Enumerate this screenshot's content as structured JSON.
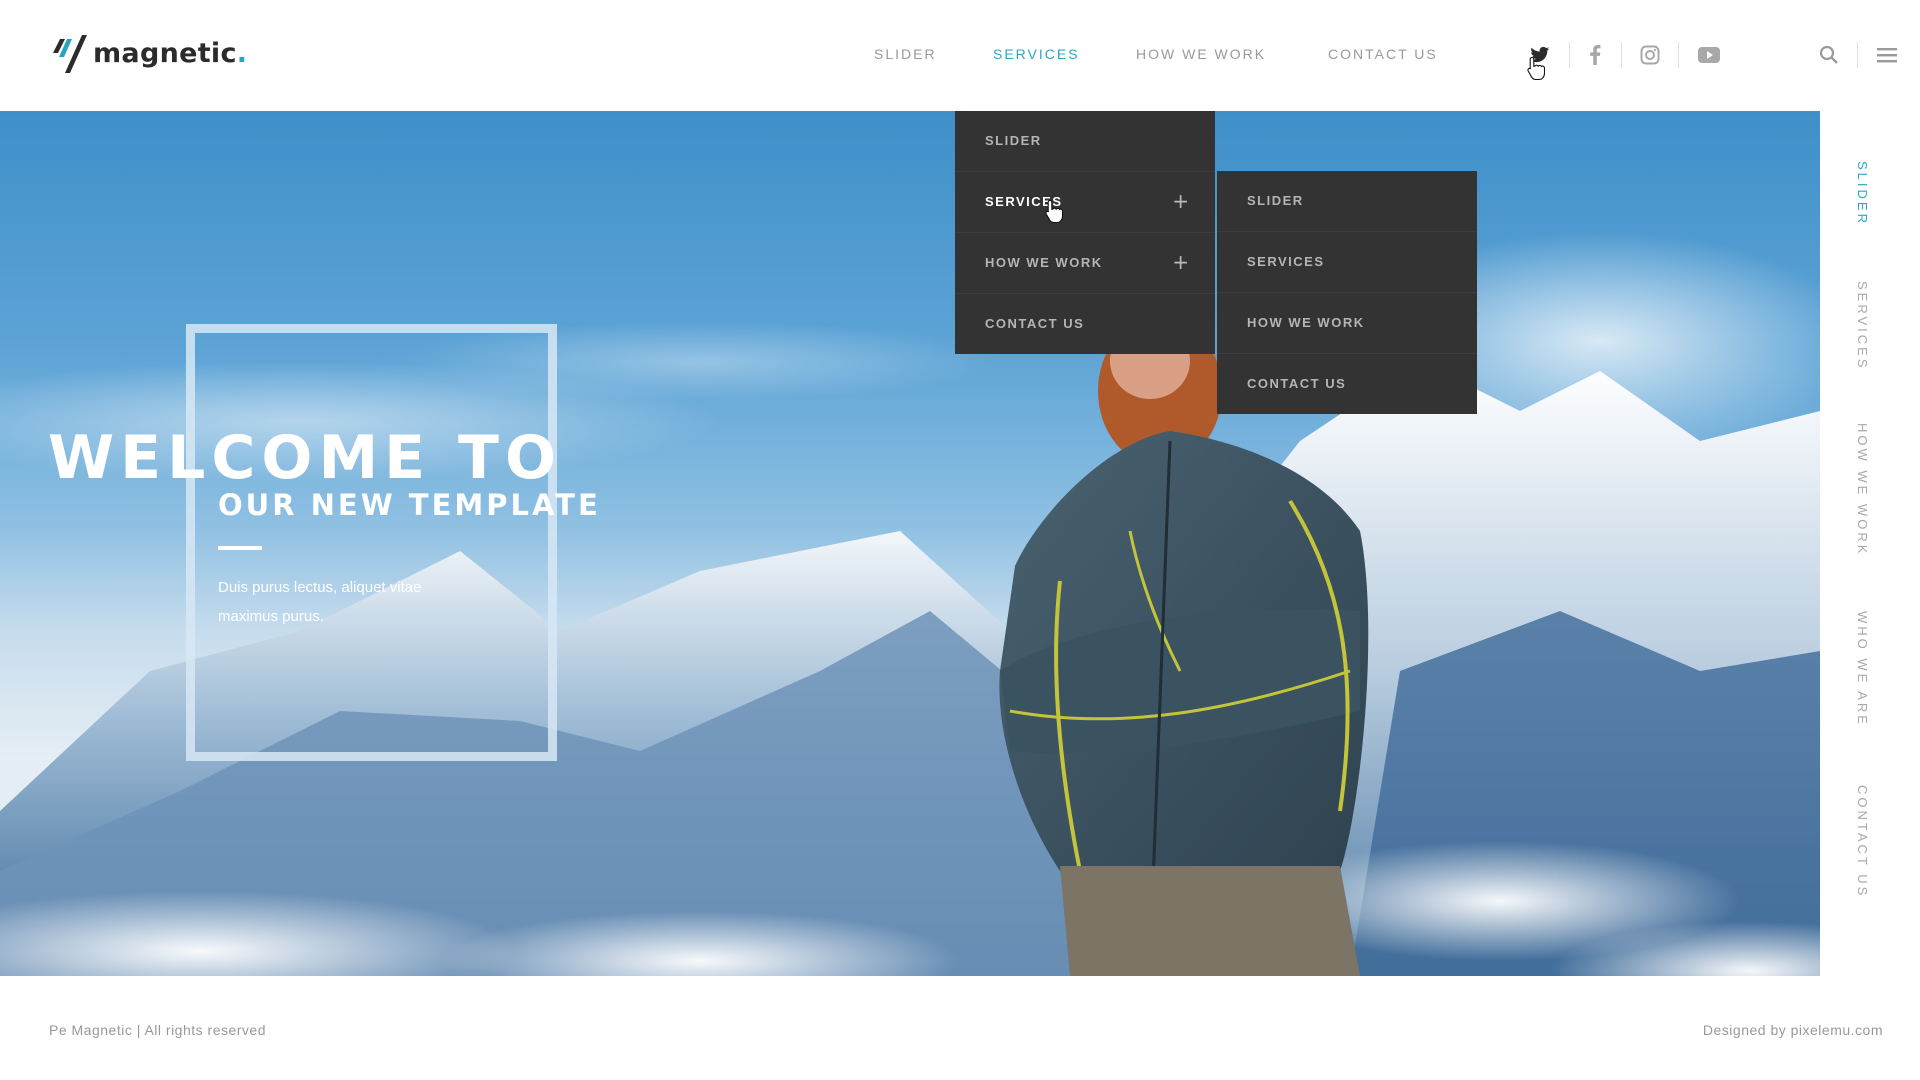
{
  "brand": {
    "name": "magnetic",
    "dot": ".",
    "accent_color": "#25a5c2"
  },
  "header": {
    "nav": [
      {
        "label": "SLIDER",
        "active": false
      },
      {
        "label": "SERVICES",
        "active": true
      },
      {
        "label": "HOW WE WORK",
        "active": false
      },
      {
        "label": "CONTACT US",
        "active": false
      }
    ],
    "social_icons": [
      "twitter-icon",
      "facebook-icon",
      "instagram-icon",
      "youtube-icon"
    ],
    "tools": [
      "search-icon",
      "menu-icon"
    ]
  },
  "dropdown": {
    "items": [
      {
        "label": "SLIDER",
        "has_sub": false
      },
      {
        "label": "SERVICES",
        "has_sub": true,
        "sub_toggle": "+"
      },
      {
        "label": "HOW WE WORK",
        "has_sub": true,
        "sub_toggle": "+"
      },
      {
        "label": "CONTACT US",
        "has_sub": false
      }
    ],
    "submenu": [
      {
        "label": "SLIDER"
      },
      {
        "label": "SERVICES"
      },
      {
        "label": "HOW WE WORK"
      },
      {
        "label": "CONTACT US"
      }
    ]
  },
  "hero": {
    "title": "WELCOME TO",
    "subtitle": "OUR NEW TEMPLATE",
    "text": "Duis purus lectus, aliquet vitae maximus purus."
  },
  "side_nav": [
    {
      "label": "SLIDER",
      "active": true
    },
    {
      "label": "SERVICES",
      "active": false
    },
    {
      "label": "HOW WE WORK",
      "active": false
    },
    {
      "label": "WHO WE ARE",
      "active": false
    },
    {
      "label": "CONTACT US",
      "active": false
    }
  ],
  "footer": {
    "left": "Pe Magnetic | All rights reserved",
    "right": "Designed by pixelemu.com"
  },
  "colors": {
    "accent": "#2ba8c4",
    "dropdown_bg": "#333333",
    "text_muted": "#9a9a9a"
  }
}
